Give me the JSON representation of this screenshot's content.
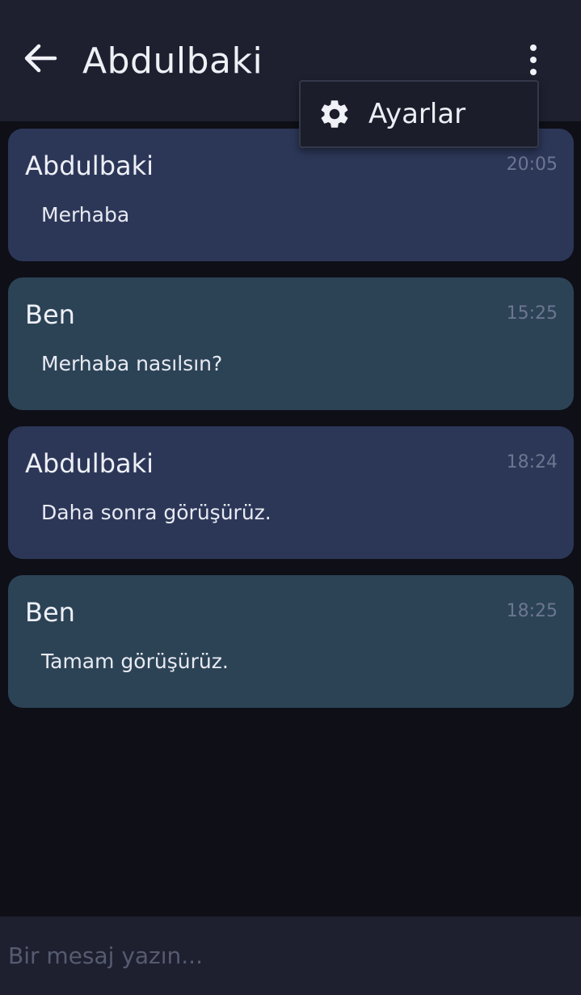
{
  "header": {
    "title": "Abdulbaki",
    "back_icon": "arrow-left-icon",
    "menu_icon": "more-vertical-icon"
  },
  "menu": {
    "items": [
      {
        "label": "Ayarlar",
        "icon": "gear-icon"
      }
    ]
  },
  "messages": [
    {
      "sender": "Abdulbaki",
      "time": "20:05",
      "text": "Merhaba",
      "from": "them"
    },
    {
      "sender": "Ben",
      "time": "15:25",
      "text": "Merhaba nasılsın?",
      "from": "me"
    },
    {
      "sender": "Abdulbaki",
      "time": "18:24",
      "text": "Daha sonra görüşürüz.",
      "from": "them"
    },
    {
      "sender": "Ben",
      "time": "18:25",
      "text": "Tamam görüşürüz.",
      "from": "me"
    }
  ],
  "composer": {
    "placeholder": "Bir mesaj yazın...",
    "value": ""
  },
  "colors": {
    "background": "#0e0f17",
    "bar": "#1e2030",
    "bubble_them": "#2c3758",
    "bubble_me": "#2c4356"
  }
}
